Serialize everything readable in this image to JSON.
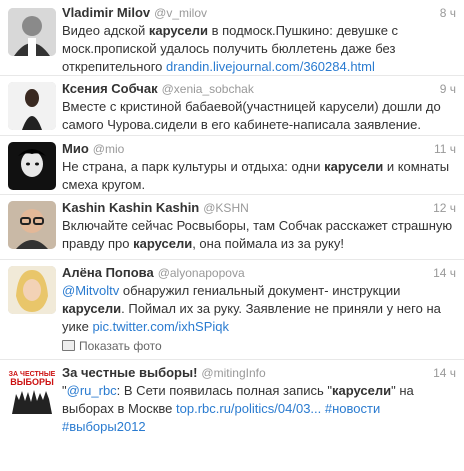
{
  "tweets": [
    {
      "name": "Vladimir Milov",
      "handle": "@v_milov",
      "time": "8 ч",
      "text_parts": [
        "Видео адской ",
        "карусели",
        " в подмоск.Пушкино: девушке с моск.пропиской удалось получить бюллетень даже без открепительного "
      ],
      "link": "drandin.livejournal.com/360284.html"
    },
    {
      "name": "Ксения Собчак",
      "handle": "@xenia_sobchak",
      "time": "9 ч",
      "text_parts": [
        "Вместе с кристиной бабаевой(участницей карусели) дошли до самого Чурова.сидели в его кабинете-написала заявление."
      ]
    },
    {
      "name": "Мио",
      "handle": "@mio",
      "time": "11 ч",
      "text_parts": [
        "Не страна, а парк культуры и отдыха: одни ",
        "карусели",
        " и комнаты смеха кругом."
      ]
    },
    {
      "name": "Kashin Kashin Kashin",
      "handle": "@KSHN",
      "time": "12 ч",
      "text_parts": [
        "Включайте сейчас Росвыборы, там Собчак расскажет страшную правду про ",
        "карусели",
        ", она поймала из за руку!"
      ]
    },
    {
      "name": "Алёна Попова",
      "handle": "@alyonapopova",
      "time": "14 ч",
      "mention": "@Mitvoltv",
      "text_parts": [
        " обнаружил гениальный документ- инструкции ",
        "карусели",
        ". Поймал их за руку. Заявление не приняли у него на уике "
      ],
      "link": "pic.twitter.com/ixhSPiqk",
      "photo_label": "Показать фото"
    },
    {
      "name": "За честные выборы!",
      "handle": "@mitingInfo",
      "time": "14 ч",
      "avatar_text": [
        "ЗА ЧЕСТНЫЕ",
        "ВЫБОРЫ"
      ],
      "quote_open": "\"",
      "mention": "@ru_rbc",
      "text_parts": [
        ": В Сети появилась полная запись \"",
        "карусели",
        "\" на выборах в Москве "
      ],
      "link": "top.rbc.ru/politics/04/03...",
      "tags": [
        "#новости",
        "#выборы2012"
      ]
    }
  ]
}
